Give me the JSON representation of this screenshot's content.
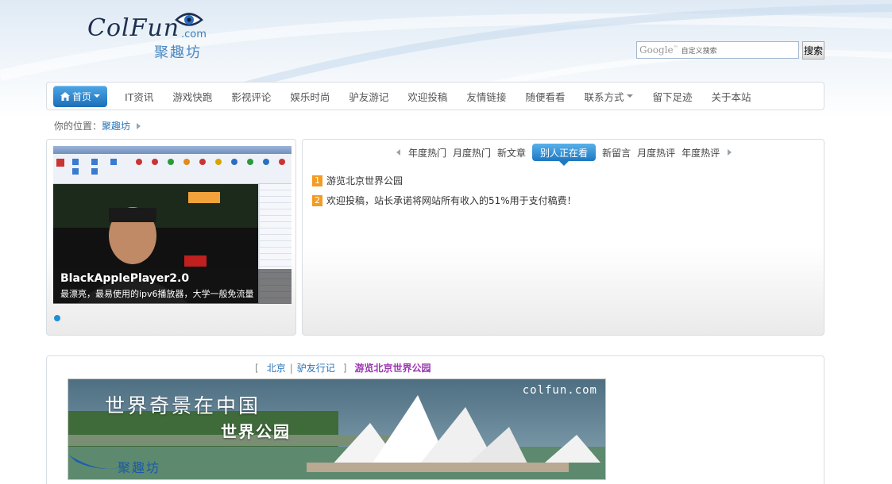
{
  "site": {
    "logo_text": "ColFun",
    "logo_domain": ".com",
    "logo_cn": "聚趣坊"
  },
  "search": {
    "brand": "Google",
    "placeholder": "自定义搜索",
    "button_label": "搜索"
  },
  "nav": {
    "home_label": "首页",
    "items": [
      "IT资讯",
      "游戏快跑",
      "影视评论",
      "娱乐时尚",
      "驴友游记",
      "欢迎投稿",
      "友情链接",
      "随便看看",
      "联系方式",
      "留下足迹",
      "关于本站"
    ]
  },
  "breadcrumb": {
    "prefix": "你的位置：",
    "current": "聚趣坊"
  },
  "slider": {
    "title": "BlackApplePlayer2.0",
    "desc": "最漂亮，最易使用的ipv6播放器，大学一般免流量"
  },
  "tabs": {
    "items": [
      "年度热门",
      "月度热门",
      "新文章",
      "别人正在看",
      "新留言",
      "月度热评",
      "年度热评"
    ],
    "active_index": 3
  },
  "list": [
    {
      "num": "1",
      "text": "游览北京世界公园"
    },
    {
      "num": "2",
      "text": "欢迎投稿，站长承诺将网站所有收入的51%用于支付稿费！"
    }
  ],
  "article": {
    "cat1": "北京",
    "cat2": "驴友行记",
    "title": "游览北京世界公园",
    "banner_title": "世界奇景在中国",
    "banner_subtitle": "世界公园",
    "banner_site": "colfun.com",
    "banner_logo": "聚趣坊"
  },
  "colors": {
    "accent": "#1e78c2",
    "title_purple": "#9b34b0",
    "link": "#2a74b8",
    "badge": "#f39b24"
  }
}
